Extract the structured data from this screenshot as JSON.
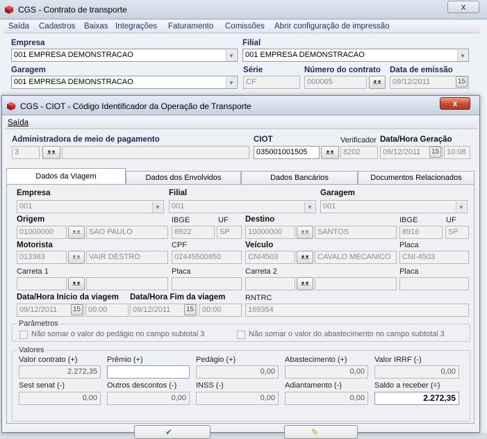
{
  "main_window": {
    "title": "CGS - Contrato de transporte",
    "close_glyph": "x",
    "menu": [
      "Saída",
      "Cadastros",
      "Baixas",
      "Integrações",
      "Faturamento",
      "Comissões",
      "Abrir configuração de impressão"
    ],
    "empresa": {
      "label": "Empresa",
      "value": "001 EMPRESA DEMONSTRACAO"
    },
    "filial": {
      "label": "Filial",
      "value": "001 EMPRESA DEMONSTRACAO"
    },
    "garagem": {
      "label": "Garagem",
      "value": "001 EMPRESA DEMONSTRACAO"
    },
    "serie": {
      "label": "Série",
      "value": "CF"
    },
    "numero_contrato": {
      "label": "Número do contrato",
      "value": "000065"
    },
    "data_emissao": {
      "label": "Data de emissão",
      "value": "09/12/2011"
    }
  },
  "dialog": {
    "title": "CGS - CIOT - Código Identificador da Operação de Transporte",
    "close_glyph": "x",
    "menu_saida": "Saída",
    "administradora": {
      "label": "Administradora de meio de pagamento",
      "code": "3",
      "name": ""
    },
    "ciot": {
      "label": "CIOT",
      "value": "035001001505"
    },
    "verificador": {
      "label": "Verificador",
      "value": "8202"
    },
    "geracao": {
      "label": "Data/Hora Geração",
      "date": "09/12/2011",
      "time": "10:08"
    },
    "tabs": [
      "Dados da Viagem",
      "Dados dos Envolvidos",
      "Dados Bancários",
      "Documentos Relacionados"
    ],
    "viagem": {
      "empresa": {
        "label": "Empresa",
        "value": "001"
      },
      "filial": {
        "label": "Filial",
        "value": "001"
      },
      "garagem": {
        "label": "Garagem",
        "value": "001"
      },
      "origem": {
        "label": "Origem",
        "code": "01000000",
        "name": "SAO PAULO"
      },
      "ibge_origem": {
        "label": "IBGE",
        "value": "8922"
      },
      "uf_origem": {
        "label": "UF",
        "value": "SP"
      },
      "destino": {
        "label": "Destino",
        "code": "10000000",
        "name": "SANTOS"
      },
      "ibge_destino": {
        "label": "IBGE",
        "value": "8916"
      },
      "uf_destino": {
        "label": "UF",
        "value": "SP"
      },
      "motorista": {
        "label": "Motorista",
        "code": "013363",
        "name": "VAIR DESTRO"
      },
      "cpf": {
        "label": "CPF",
        "value": "02445500850"
      },
      "veiculo": {
        "label": "Veículo",
        "code": "CNI4503",
        "name": "CAVALO MECANICO"
      },
      "placa": {
        "label": "Placa",
        "value": "CNI-4503"
      },
      "carreta1": {
        "label": "Carreta 1",
        "code": "",
        "name": ""
      },
      "placa1": {
        "label": "Placa",
        "value": ""
      },
      "carreta2": {
        "label": "Carreta 2",
        "code": "",
        "name": ""
      },
      "placa2": {
        "label": "Placa",
        "value": ""
      },
      "inicio": {
        "label": "Data/Hora Início da viagem",
        "date": "09/12/2011",
        "time": "00:00"
      },
      "fim": {
        "label": "Data/Hora Fim da viagem",
        "date": "09/12/2011",
        "time": "00:00"
      },
      "rntrc": {
        "label": "RNTRC",
        "value": "169354"
      },
      "parametros": {
        "title": "Parâmetros",
        "opt1": "Não somar o valor do pedágio no campo subtotal 3",
        "opt2": "Não somar o valor do abastecimento no campo subtotal 3"
      },
      "valores": {
        "title": "Valores",
        "valor_contrato": {
          "label": "Valor contrato (+)",
          "value": "2.272,35"
        },
        "premio": {
          "label": "Prêmio (+)",
          "value": ""
        },
        "pedagio": {
          "label": "Pedágio (+)",
          "value": "0,00"
        },
        "abastecimento": {
          "label": "Abastecimento (+)",
          "value": "0,00"
        },
        "irrf": {
          "label": "Valor IRRF (-)",
          "value": "0,00"
        },
        "sest": {
          "label": "Sest senat (-)",
          "value": "0,00"
        },
        "outros": {
          "label": "Outros descontos (-)",
          "value": "0,00"
        },
        "inss": {
          "label": "INSS (-)",
          "value": "0,00"
        },
        "adiantamento": {
          "label": "Adiantamento (-)",
          "value": "0,00"
        },
        "saldo": {
          "label": "Saldo a receber (=)",
          "value": "2.272,35"
        }
      }
    }
  },
  "icons": {
    "search": "binoculars-icon",
    "calendar": "calendar-icon",
    "dropdown": "chevron-down-icon"
  },
  "colors": {
    "label_blue": "#1f2b66",
    "close_red": "#c9472a",
    "title_bar": "#c6d2e2"
  }
}
